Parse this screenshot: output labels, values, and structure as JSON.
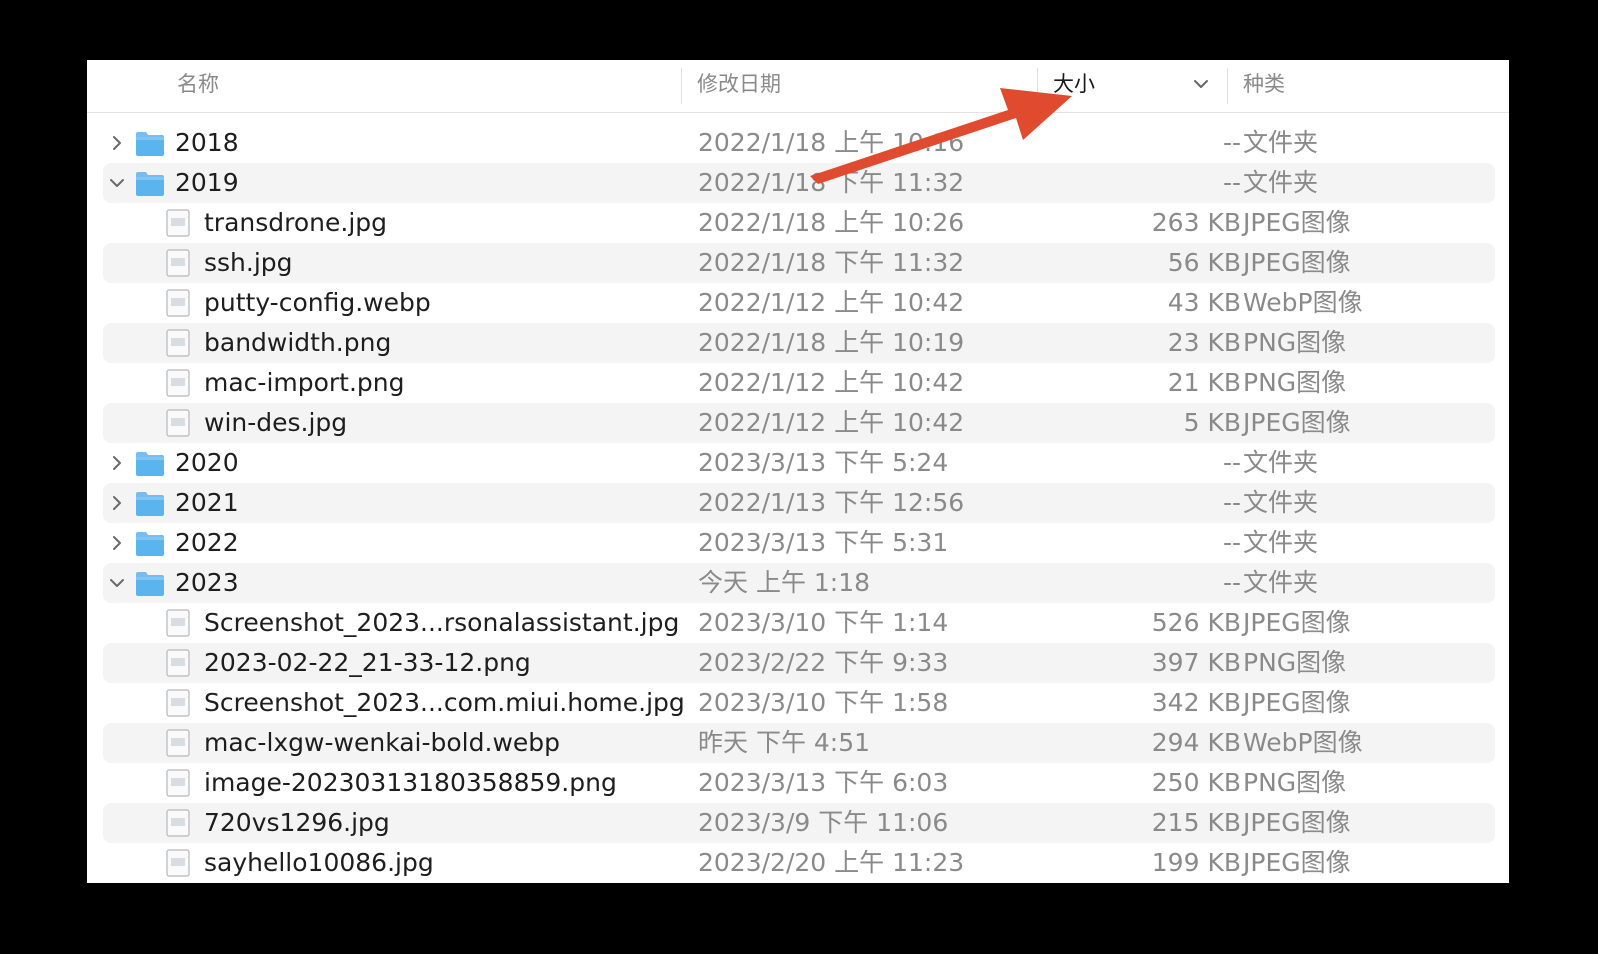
{
  "header": {
    "name_label": "名称",
    "date_label": "修改日期",
    "size_label": "大小",
    "kind_label": "种类"
  },
  "rows": [
    {
      "name": "2018",
      "date": "2022/1/18 上午 10:16",
      "size": "--",
      "kind": "文件夹",
      "type": "folder",
      "expanded": false,
      "icon": "folder-icon"
    },
    {
      "name": "2019",
      "date": "2022/1/18 下午 11:32",
      "size": "--",
      "kind": "文件夹",
      "type": "folder",
      "expanded": true,
      "icon": "folder-icon"
    },
    {
      "name": "transdrone.jpg",
      "date": "2022/1/18 上午 10:26",
      "size": "263 KB",
      "kind": "JPEG图像",
      "type": "file",
      "icon": "image-file-icon"
    },
    {
      "name": "ssh.jpg",
      "date": "2022/1/18 下午 11:32",
      "size": "56 KB",
      "kind": "JPEG图像",
      "type": "file",
      "icon": "image-file-icon"
    },
    {
      "name": "putty-config.webp",
      "date": "2022/1/12 上午 10:42",
      "size": "43 KB",
      "kind": "WebP图像",
      "type": "file",
      "icon": "image-file-icon"
    },
    {
      "name": "bandwidth.png",
      "date": "2022/1/18 上午 10:19",
      "size": "23 KB",
      "kind": "PNG图像",
      "type": "file",
      "icon": "image-file-icon"
    },
    {
      "name": "mac-import.png",
      "date": "2022/1/12 上午 10:42",
      "size": "21 KB",
      "kind": "PNG图像",
      "type": "file",
      "icon": "image-file-icon"
    },
    {
      "name": "win-des.jpg",
      "date": "2022/1/12 上午 10:42",
      "size": "5 KB",
      "kind": "JPEG图像",
      "type": "file",
      "icon": "image-file-icon"
    },
    {
      "name": "2020",
      "date": "2023/3/13 下午 5:24",
      "size": "--",
      "kind": "文件夹",
      "type": "folder",
      "expanded": false,
      "icon": "folder-icon"
    },
    {
      "name": "2021",
      "date": "2022/1/13 下午 12:56",
      "size": "--",
      "kind": "文件夹",
      "type": "folder",
      "expanded": false,
      "icon": "folder-icon"
    },
    {
      "name": "2022",
      "date": "2023/3/13 下午 5:31",
      "size": "--",
      "kind": "文件夹",
      "type": "folder",
      "expanded": false,
      "icon": "folder-icon"
    },
    {
      "name": "2023",
      "date": "今天 上午 1:18",
      "size": "--",
      "kind": "文件夹",
      "type": "folder",
      "expanded": true,
      "icon": "folder-icon"
    },
    {
      "name": "Screenshot_2023...rsonalassistant.jpg",
      "date": "2023/3/10 下午 1:14",
      "size": "526 KB",
      "kind": "JPEG图像",
      "type": "file",
      "icon": "image-file-icon"
    },
    {
      "name": "2023-02-22_21-33-12.png",
      "date": "2023/2/22 下午 9:33",
      "size": "397 KB",
      "kind": "PNG图像",
      "type": "file",
      "icon": "image-file-icon"
    },
    {
      "name": "Screenshot_2023...com.miui.home.jpg",
      "date": "2023/3/10 下午 1:58",
      "size": "342 KB",
      "kind": "JPEG图像",
      "type": "file",
      "icon": "image-file-icon"
    },
    {
      "name": "mac-lxgw-wenkai-bold.webp",
      "date": "昨天 下午 4:51",
      "size": "294 KB",
      "kind": "WebP图像",
      "type": "file",
      "icon": "image-file-icon"
    },
    {
      "name": "image-20230313180358859.png",
      "date": "2023/3/13 下午 6:03",
      "size": "250 KB",
      "kind": "PNG图像",
      "type": "file",
      "icon": "image-file-icon"
    },
    {
      "name": "720vs1296.jpg",
      "date": "2023/3/9 下午 11:06",
      "size": "215 KB",
      "kind": "JPEG图像",
      "type": "file",
      "icon": "image-file-icon"
    },
    {
      "name": "sayhello10086.jpg",
      "date": "2023/2/20 上午 11:23",
      "size": "199 KB",
      "kind": "JPEG图像",
      "type": "file",
      "icon": "image-file-icon"
    }
  ],
  "colors": {
    "folder": "#5ab4ee",
    "arrow": "#e04a2f",
    "alt_row": "#f4f4f4"
  }
}
